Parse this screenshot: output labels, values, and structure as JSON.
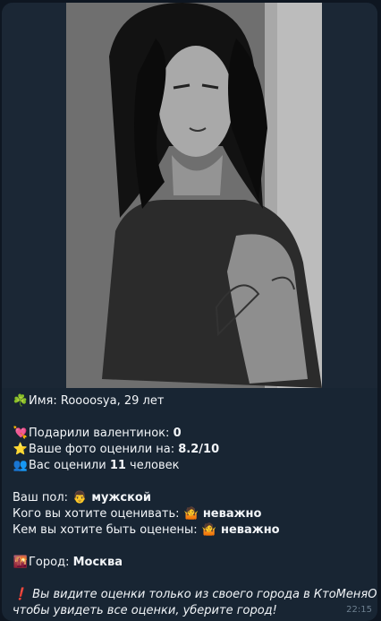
{
  "profile": {
    "name_label": "Имя:",
    "name_value": "Roooosya, 29 лет"
  },
  "stats": {
    "valentines_label": "Подарили валентинок:",
    "valentines_value": "0",
    "rating_label": "Ваше фото оценили на:",
    "rating_value": "8.2/10",
    "raters_prefix": "Вас оценили",
    "raters_count": "11",
    "raters_suffix": "человек"
  },
  "prefs": {
    "gender_label": "Ваш пол:",
    "gender_value": "мужской",
    "rate_whom_label": "Кого вы хотите оценивать:",
    "rate_whom_value": "неважно",
    "rated_by_label": "Кем вы хотите быть оценены:",
    "rated_by_value": "неважно"
  },
  "city": {
    "label": "Город:",
    "value": "Москва"
  },
  "notice": {
    "line1": "Вы видите оценки только из своего города в КтоМеняОценил,",
    "line2": "чтобы увидеть все оценки, уберите город!"
  },
  "time": "22:15",
  "icons": {
    "clover": "☘️",
    "heart": "💘",
    "star": "⭐",
    "people": "👥",
    "man": "👨",
    "shrug": "🤷",
    "city": "🌇",
    "exclamation": "❗"
  },
  "colors": {
    "background": "#0e1621",
    "bubble": "#182533",
    "text": "#f2f5f8",
    "time": "#6d7f8f"
  }
}
